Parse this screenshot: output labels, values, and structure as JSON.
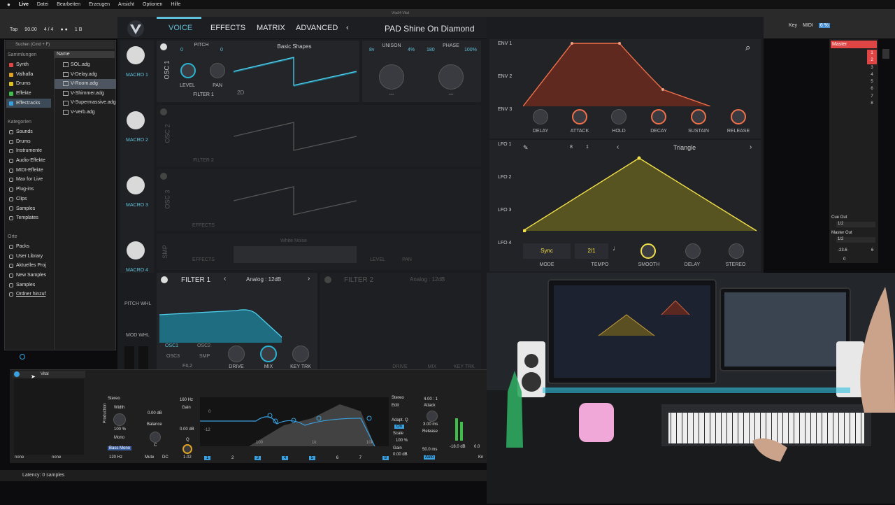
{
  "menubar": {
    "apple": "",
    "items": [
      "Live",
      "Datei",
      "Bearbeiten",
      "Erzeugen",
      "Ansicht",
      "Optionen",
      "Hilfe"
    ]
  },
  "live_toolbar": {
    "tap": "Tap",
    "tempo": "90.00",
    "signature": "4 / 4",
    "bars": "1 B"
  },
  "browser": {
    "search_placeholder": "Suchen (Cmd + F)",
    "sammlungen_title": "Sammlungen",
    "sammlungen": [
      {
        "label": "Synth",
        "color": "#e04545"
      },
      {
        "label": "Valhalla",
        "color": "#e0a020"
      },
      {
        "label": "Drums",
        "color": "#e0c020"
      },
      {
        "label": "Effekte",
        "color": "#3fbf4a"
      },
      {
        "label": "Effectracks",
        "color": "#3aa0e0"
      }
    ],
    "kategorien_title": "Kategorien",
    "kategorien": [
      "Sounds",
      "Drums",
      "Instrumente",
      "Audio-Effekte",
      "MIDI-Effekte",
      "Max for Live",
      "Plug-ins",
      "Clips",
      "Samples",
      "Templates"
    ],
    "orte_title": "Orte",
    "orte": [
      "Packs",
      "User Library",
      "Aktuelles Proj",
      "New Samples",
      "Samples",
      "Ordner hinzuf"
    ],
    "name_header": "Name",
    "files": [
      "SOL.adg",
      "V-Delay.adg",
      "V-Room.adg",
      "V-Shimmer.adg",
      "V-Supermassive.adg",
      "V-Verb.adg"
    ]
  },
  "vital": {
    "window_title": "Vital/4-Vital",
    "tabs": [
      "VOICE",
      "EFFECTS",
      "MATRIX",
      "ADVANCED"
    ],
    "preset": "PAD Shine On Diamond",
    "macros": [
      "MACRO 1",
      "MACRO 2",
      "MACRO 3",
      "MACRO 4"
    ],
    "side_labels": [
      "PITCH WHL",
      "MOD WHL"
    ],
    "osc1": {
      "label": "OSC 1",
      "pitch": "PITCH",
      "pitch_left": "0",
      "pitch_right": "0",
      "wavetable": "Basic Shapes",
      "level": "LEVEL",
      "pan": "PAN",
      "filter": "FILTER 1",
      "mode": "2D",
      "unison": "UNISON",
      "voices": "8v",
      "detune": "4%",
      "phase": "PHASE",
      "phase_val": "180",
      "phase_pct": "100%",
      "spread_left": "---",
      "spread_right": "---"
    },
    "osc2": {
      "label": "OSC 2",
      "filter": "FILTER 2"
    },
    "osc3": {
      "label": "OSC 3",
      "filter": "EFFECTS"
    },
    "smp": {
      "label": "SMP",
      "sample": "White Noise",
      "filter": "EFFECTS",
      "level": "LEVEL",
      "pan": "PAN"
    },
    "filter1": {
      "label": "FILTER 1",
      "type": "Analog : 12dB",
      "routes": [
        "OSC1",
        "OSC2",
        "OSC3",
        "SMP"
      ],
      "fil2": "FIL2",
      "drive": "DRIVE",
      "mix": "MIX",
      "key_trk": "KEY TRK"
    },
    "filter2": {
      "label": "FILTER 2",
      "type": "Analog : 12dB",
      "drive": "DRIVE",
      "mix": "MIX",
      "key_trk": "KEY TRK"
    },
    "env": {
      "rows": [
        "ENV 1",
        "ENV 2",
        "ENV 3"
      ],
      "knobs": [
        "DELAY",
        "ATTACK",
        "HOLD",
        "DECAY",
        "SUSTAIN",
        "RELEASE"
      ]
    },
    "lfo": {
      "rows": [
        "LFO 1",
        "LFO 2",
        "LFO 3",
        "LFO 4"
      ],
      "shape": "Triangle",
      "grid_a": "8",
      "grid_b": "1",
      "mode_value": "Sync",
      "tempo_value": "2/1",
      "knobs": [
        "MODE",
        "TEMPO",
        "SMOOTH",
        "DELAY",
        "STEREO"
      ]
    }
  },
  "devices": {
    "track": "Vital",
    "utility": {
      "stereo": "Stereo",
      "width": "Width",
      "width_val": "100 %",
      "mono": "Mono",
      "bass_mono": "Bass Mono",
      "bass_freq": "120 Hz",
      "none_a": "none",
      "none_b": "none"
    },
    "gain": {
      "freq": "160 Hz",
      "gain": "Gain",
      "gain_val": "0.00 dB",
      "balance": "Balance",
      "balance_val": "C",
      "gain2": "0.00 dB",
      "q": "Q",
      "q_val": "1.02",
      "mute": "Mute",
      "dc": "DC"
    },
    "eq_bands": [
      "1",
      "2",
      "3",
      "4",
      "5",
      "6",
      "7",
      "8"
    ],
    "eq_marks": [
      "0",
      "-12",
      "100",
      "1k",
      "10k"
    ],
    "comp": {
      "stereo": "Stereo",
      "edit": "Edit",
      "adapt": "Adapt. Q",
      "on": "On",
      "scale": "Scale",
      "scale_val": "100 %",
      "gain": "Gain",
      "gain_val": "0.00 dB",
      "ratio": "4.00 : 1",
      "attack": "Attack",
      "attack_val": "3.00 ms",
      "release": "Release",
      "release_val": "50.0 ms",
      "auto": "Auto",
      "db": "-18.0 dB",
      "zero": "0.0",
      "knee": "Kn"
    }
  },
  "status": {
    "latency": "Latency: 0 samples"
  },
  "master": {
    "title": "Master",
    "cue": "Cue Out",
    "cue_val": "1/2",
    "mout": "Master Out",
    "mout_val": "1/2",
    "vol": "-23.6",
    "vol2": "0",
    "num": "6",
    "slots": [
      "1",
      "2",
      "3",
      "4",
      "5",
      "6",
      "7",
      "8"
    ]
  },
  "top_right": {
    "key": "Key",
    "midi": "MIDI",
    "cpu": "6 %"
  }
}
